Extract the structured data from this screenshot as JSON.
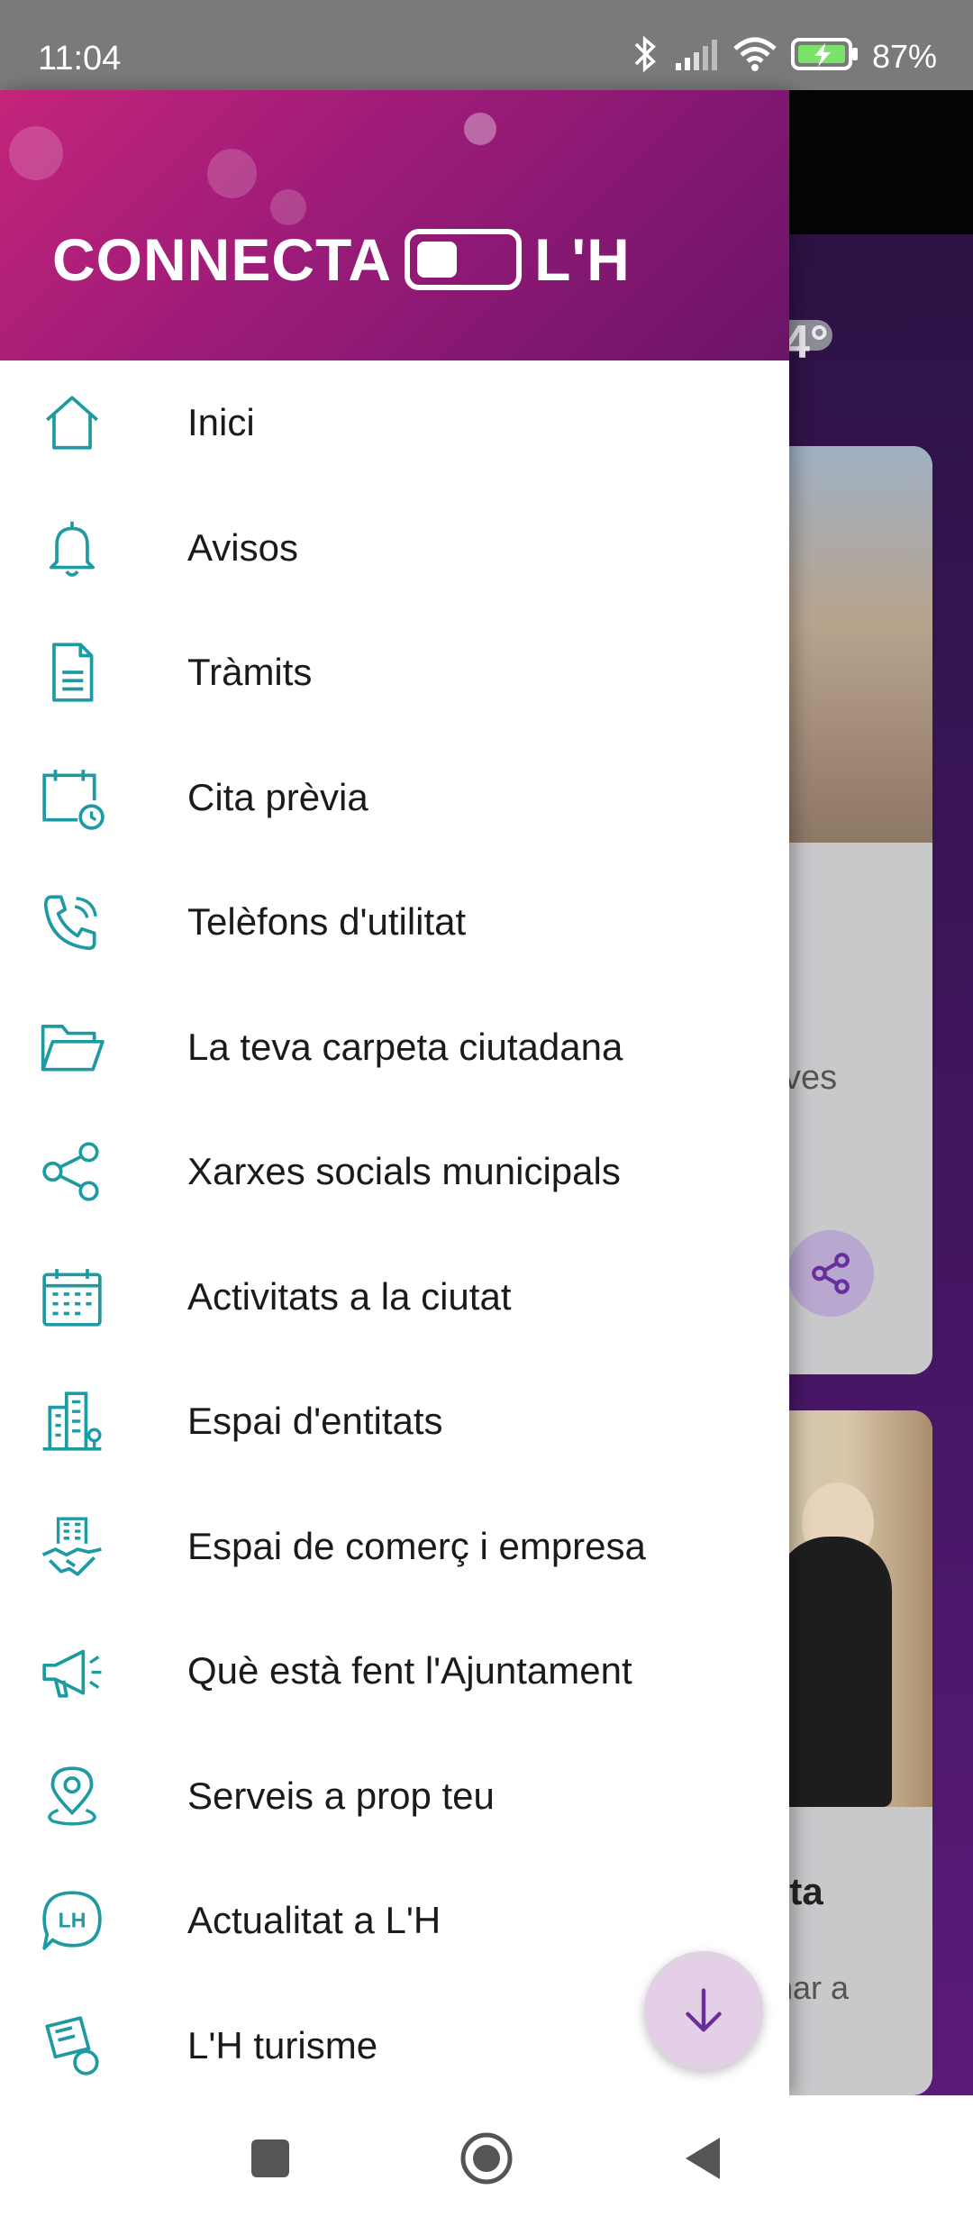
{
  "status_bar": {
    "time": "11:04",
    "battery_percent": "87%",
    "icons": [
      "bluetooth-icon",
      "signal-icon",
      "wifi-icon",
      "battery-charging-icon"
    ]
  },
  "background_app": {
    "weather_temp": "4°",
    "card1_text": "ves",
    "card2_title": "rta",
    "card2_text": "nar a"
  },
  "drawer": {
    "logo_left": "CONNECTA",
    "logo_right": "L'H",
    "accent_color": "#1e9aa3",
    "items": [
      {
        "label": "Inici",
        "icon": "home-icon"
      },
      {
        "label": "Avisos",
        "icon": "bell-icon"
      },
      {
        "label": "Tràmits",
        "icon": "document-icon"
      },
      {
        "label": "Cita prèvia",
        "icon": "calendar-clock-icon"
      },
      {
        "label": "Telèfons d'utilitat",
        "icon": "phone-icon"
      },
      {
        "label": "La teva carpeta ciutadana",
        "icon": "folder-icon"
      },
      {
        "label": "Xarxes socials municipals",
        "icon": "share-icon"
      },
      {
        "label": "Activitats a la ciutat",
        "icon": "calendar-icon"
      },
      {
        "label": "Espai d'entitats",
        "icon": "building-icon"
      },
      {
        "label": "Espai de comerç i empresa",
        "icon": "handshake-icon"
      },
      {
        "label": "Què està fent l'Ajuntament",
        "icon": "megaphone-icon"
      },
      {
        "label": "Serveis a prop teu",
        "icon": "location-pin-icon"
      },
      {
        "label": "Actualitat a L'H",
        "icon": "lh-chat-icon"
      },
      {
        "label": "L'H turisme",
        "icon": "tourism-icon"
      }
    ]
  },
  "fab": {
    "icon": "arrow-down-icon"
  },
  "nav_bar": {
    "buttons": [
      "recents-button",
      "home-button",
      "back-button"
    ]
  }
}
